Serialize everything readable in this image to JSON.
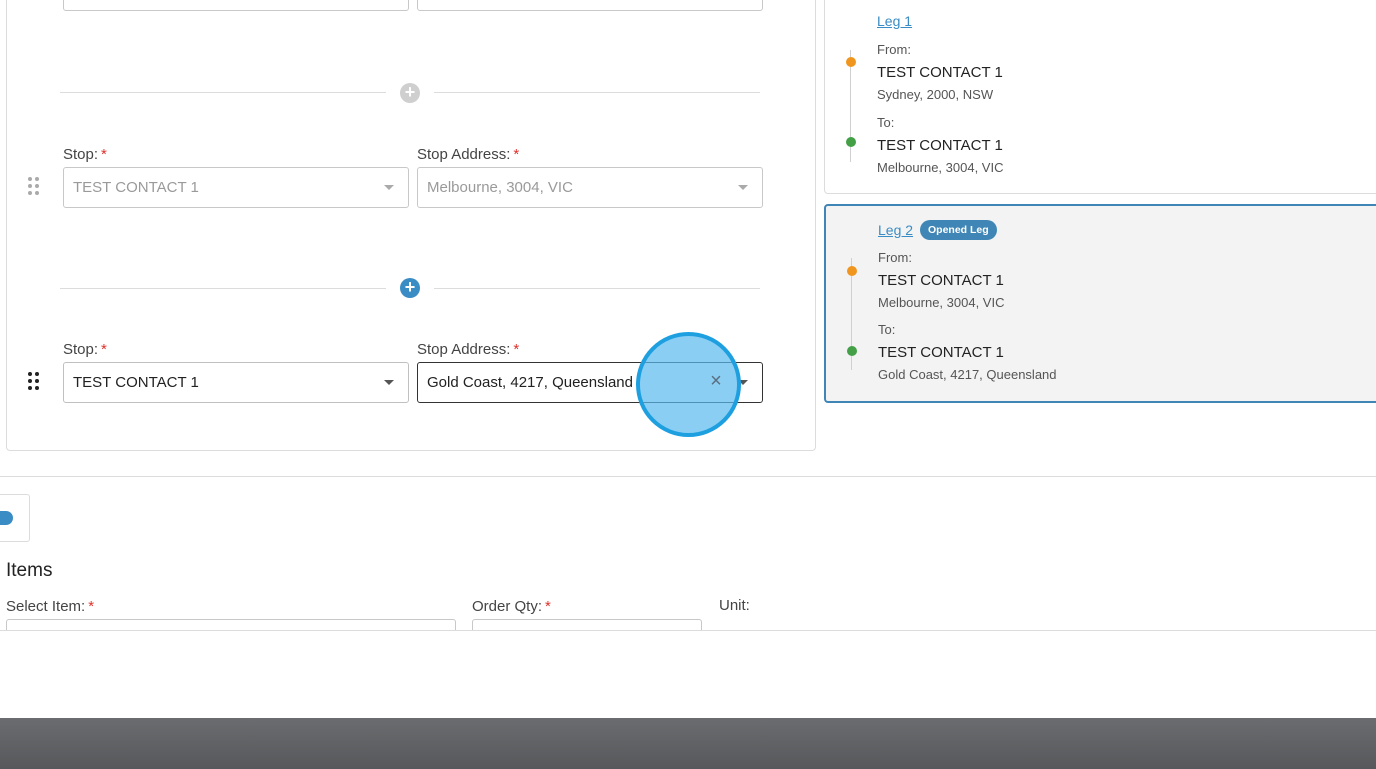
{
  "stops": [
    {
      "stop_label": "Stop:",
      "address_label": "Stop Address:",
      "required_mark": "*",
      "stop_value": "TEST CONTACT 1",
      "address_value": "Melbourne, 3004, VIC",
      "state": "disabled"
    },
    {
      "stop_label": "Stop:",
      "address_label": "Stop Address:",
      "required_mark": "*",
      "stop_value": "TEST CONTACT 1",
      "address_value": "Gold Coast, 4217, Queensland",
      "state": "active"
    }
  ],
  "add_stop_buttons": [
    "+",
    "+"
  ],
  "legs": [
    {
      "title": "Leg 1",
      "from_label": "From:",
      "from_contact": "TEST CONTACT 1",
      "from_address": "Sydney, 2000, NSW",
      "to_label": "To:",
      "to_contact": "TEST CONTACT 1",
      "to_address": "Melbourne, 3004, VIC"
    },
    {
      "title": "Leg 2",
      "badge": "Opened Leg",
      "from_label": "From:",
      "from_contact": "TEST CONTACT 1",
      "from_address": "Melbourne, 3004, VIC",
      "to_label": "To:",
      "to_contact": "TEST CONTACT 1",
      "to_address": "Gold Coast, 4217, Queensland"
    }
  ],
  "items": {
    "title": "Items",
    "select_item_label": "Select Item:",
    "order_qty_label": "Order Qty:",
    "unit_label": "Unit:",
    "required_mark": "*"
  },
  "clear_icon": "×",
  "colors": {
    "accent": "#3a8cc4",
    "from_dot": "#f0961e",
    "to_dot": "#43a047",
    "required": "#e0312c"
  }
}
